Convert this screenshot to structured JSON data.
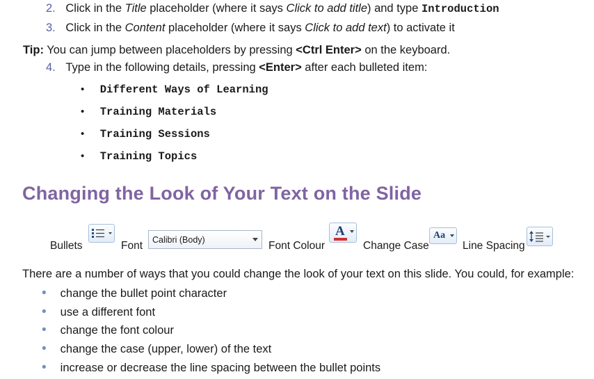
{
  "steps": [
    {
      "num": "2.",
      "pre": "Click in the ",
      "em1": "Title",
      "mid": " placeholder (where it says ",
      "em2": "Click to add title",
      "post": ") and type ",
      "code": "Introduction"
    },
    {
      "num": "3.",
      "pre": "Click in the ",
      "em1": "Content",
      "mid": " placeholder (where it says ",
      "em2": "Click to add text",
      "post": ") to activate it"
    }
  ],
  "tip": {
    "label": "Tip:",
    "pre": " You can jump between placeholders by pressing ",
    "key": "<Ctrl Enter>",
    "post": " on the keyboard."
  },
  "step4": {
    "num": "4.",
    "pre": "Type in the following details, pressing ",
    "key": "<Enter>",
    "post": " after each bulleted item:"
  },
  "details": [
    "Different Ways of Learning",
    "Training Materials",
    "Training Sessions",
    "Training Topics"
  ],
  "heading": "Changing the Look of Your Text on the Slide",
  "toolbar": {
    "bullets_label": "Bullets",
    "font_label": "Font",
    "font_value": "Calibri (Body)",
    "font_colour_label": "Font Colour",
    "change_case_label": "Change Case",
    "change_case_glyph": "Aa",
    "line_spacing_label": "Line Spacing",
    "font_colour_glyph": "A"
  },
  "intro": "There are a number of ways that you could change the look of your text on this slide. You could, for example:",
  "options": [
    "change the bullet point character",
    "use a different font",
    "change the font colour",
    "change the case (upper, lower) of the text",
    "increase or decrease the line spacing between the bullet points"
  ],
  "colors": {
    "heading": "#8064a2",
    "step_number": "#5b5ea6",
    "bullet": "#6f8fc9",
    "font_colour_bar": "#d32f2f"
  },
  "icons": [
    "bullets-icon",
    "font-colour-icon",
    "change-case-icon",
    "line-spacing-icon",
    "dropdown-arrow-icon"
  ]
}
